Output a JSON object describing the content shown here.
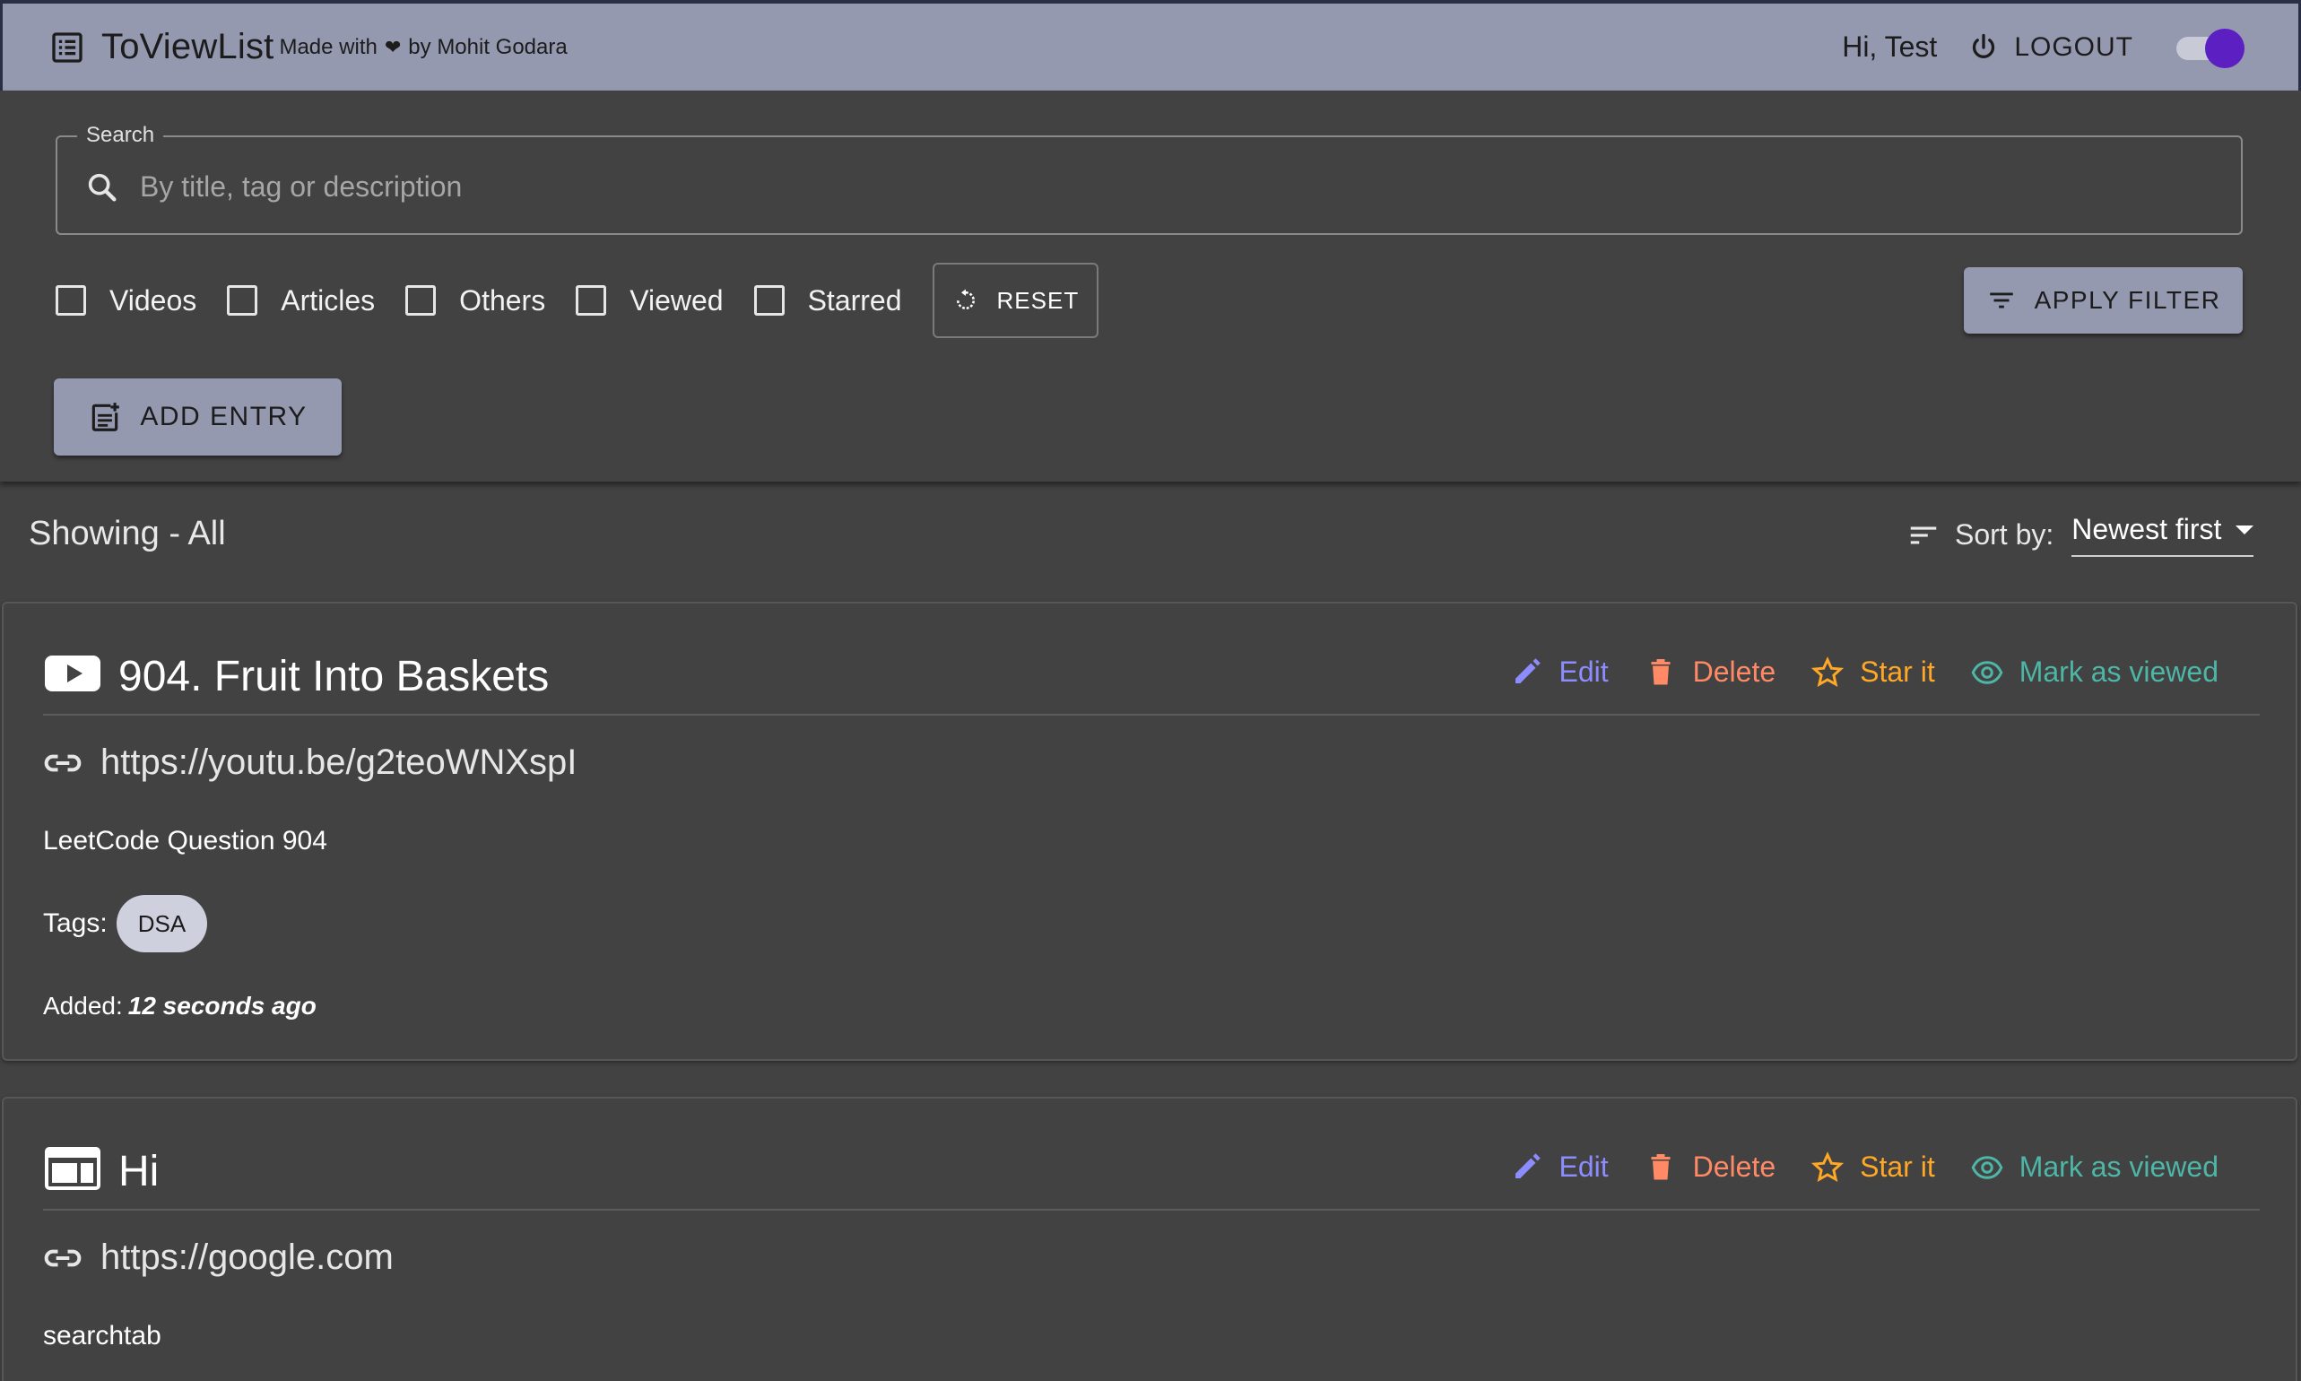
{
  "header": {
    "title": "ToViewList",
    "made_prefix": "Made with",
    "made_suffix": "by Mohit Godara",
    "greeting": "Hi, Test",
    "logout_label": "LOGOUT",
    "theme_toggle_on": true
  },
  "search": {
    "legend": "Search",
    "placeholder": "By title, tag or description",
    "value": ""
  },
  "filters": [
    {
      "label": "Videos",
      "checked": false
    },
    {
      "label": "Articles",
      "checked": false
    },
    {
      "label": "Others",
      "checked": false
    },
    {
      "label": "Viewed",
      "checked": false
    },
    {
      "label": "Starred",
      "checked": false
    }
  ],
  "reset_label": "RESET",
  "apply_label": "APPLY FILTER",
  "add_label": "ADD ENTRY",
  "showing": "Showing - All",
  "sort": {
    "label": "Sort by:",
    "value": "Newest first"
  },
  "actions": {
    "edit": "Edit",
    "delete": "Delete",
    "star": "Star it",
    "view": "Mark as viewed"
  },
  "entries": [
    {
      "type": "video",
      "type_icon": "youtube-icon",
      "title": "904. Fruit Into Baskets",
      "link": "https://youtu.be/g2teoWNXspI",
      "description": "LeetCode Question 904",
      "tags_label": "Tags:",
      "tags": [
        "DSA"
      ],
      "added_label": "Added:",
      "added_value": "12 seconds ago"
    },
    {
      "type": "article",
      "type_icon": "web-page-icon",
      "title": "Hi",
      "link": "https://google.com",
      "description": "searchtab"
    }
  ],
  "colors": {
    "background": "#424242",
    "topbar": "#9599b0",
    "edit": "#8c8cff",
    "delete": "#ff8a65",
    "star": "#ffa726",
    "view": "#4db6a6",
    "toggle_thumb": "#5b1fc2"
  }
}
